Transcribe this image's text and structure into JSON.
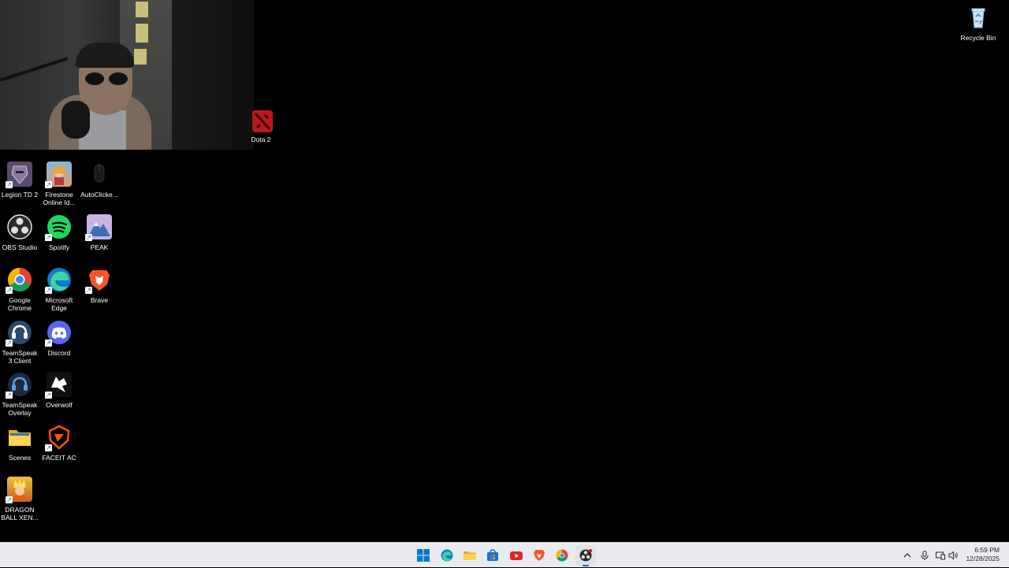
{
  "desktop": {
    "icons": [
      {
        "label": "Recycle Bin",
        "name": "recycle-bin-icon"
      },
      {
        "label": "Dota 2",
        "name": "dota-2-icon"
      },
      {
        "label": "Legion TD 2",
        "name": "legion-td-2-icon"
      },
      {
        "label": "Firestone Online Id...",
        "name": "firestone-icon"
      },
      {
        "label": "AutoClicke...",
        "name": "autoclicker-icon"
      },
      {
        "label": "OBS Studio",
        "name": "obs-studio-icon"
      },
      {
        "label": "Spotify",
        "name": "spotify-icon"
      },
      {
        "label": "PEAK",
        "name": "peak-icon"
      },
      {
        "label": "Google Chrome",
        "name": "google-chrome-icon"
      },
      {
        "label": "Microsoft Edge",
        "name": "microsoft-edge-icon"
      },
      {
        "label": "Brave",
        "name": "brave-icon"
      },
      {
        "label": "TeamSpeak 3 Client",
        "name": "teamspeak-3-icon"
      },
      {
        "label": "Discord",
        "name": "discord-icon"
      },
      {
        "label": "TeamSpeak Overlay",
        "name": "teamspeak-overlay-icon"
      },
      {
        "label": "Overwolf",
        "name": "overwolf-icon"
      },
      {
        "label": "Scenes",
        "name": "folder-icon"
      },
      {
        "label": "FACEIT AC",
        "name": "faceit-ac-icon"
      },
      {
        "label": "DRAGON BALL XEN...",
        "name": "dragon-ball-xenoverse-icon"
      }
    ]
  },
  "taskbar": {
    "apps": [
      {
        "name": "start-icon"
      },
      {
        "name": "edge-icon"
      },
      {
        "name": "file-explorer-icon"
      },
      {
        "name": "store-icon"
      },
      {
        "name": "youtube-icon"
      },
      {
        "name": "brave-icon"
      },
      {
        "name": "chrome-icon"
      },
      {
        "name": "obs-icon"
      }
    ],
    "clock": {
      "time": "6:59 PM",
      "date": "12/28/2025"
    }
  },
  "colors": {
    "taskbar_bg": "#e9ebf0",
    "accent": "#2563c9"
  }
}
